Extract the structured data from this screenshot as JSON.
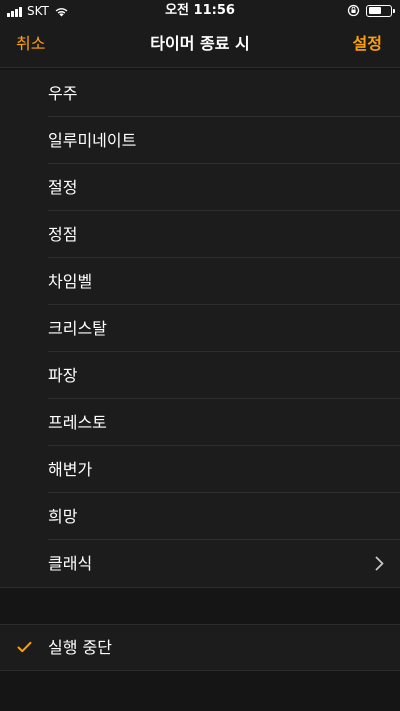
{
  "status_bar": {
    "carrier": "SKT",
    "time": "오전 11:56",
    "battery_level": 0.6
  },
  "nav": {
    "cancel_label": "취소",
    "title": "타이머 종료 시",
    "set_label": "설정"
  },
  "sounds": [
    {
      "label": "우주"
    },
    {
      "label": "일루미네이트"
    },
    {
      "label": "절정"
    },
    {
      "label": "정점"
    },
    {
      "label": "차임벨"
    },
    {
      "label": "크리스탈"
    },
    {
      "label": "파장"
    },
    {
      "label": "프레스토"
    },
    {
      "label": "해변가"
    },
    {
      "label": "희망"
    },
    {
      "label": "클래식"
    }
  ],
  "stop_option": {
    "label": "실행 중단",
    "selected": true
  },
  "colors": {
    "accent": "#ff9f0a",
    "background": "#151515",
    "cell": "#1c1c1c",
    "separator": "#2e2e2e"
  },
  "icons": [
    "signal-icon",
    "wifi-icon",
    "orientation-lock-icon",
    "battery-icon",
    "chevron-right-icon",
    "checkmark-icon"
  ]
}
